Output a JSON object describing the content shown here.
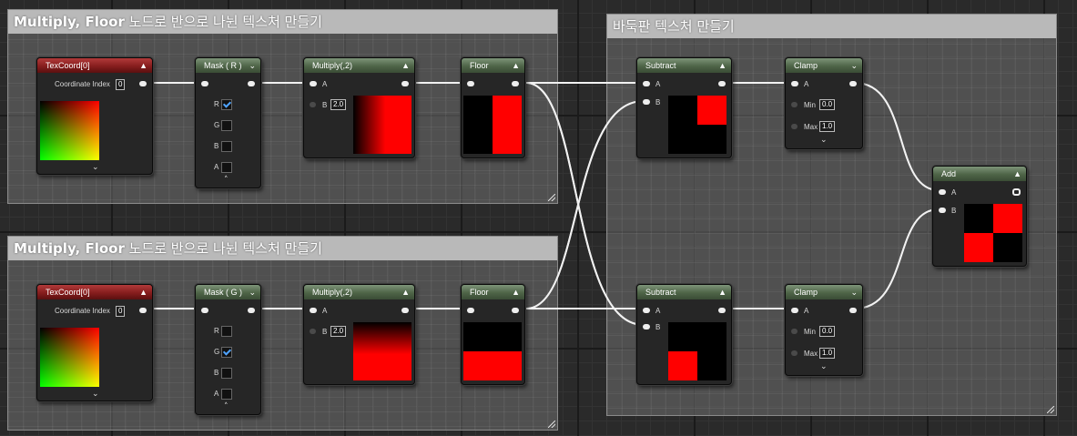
{
  "comments": {
    "top_left": {
      "title_bold": "Multiply, Floor",
      "title_rest": " 노드로 반으로 나뉜 텍스처 만들기"
    },
    "bottom_left": {
      "title_bold": "Multiply, Floor",
      "title_rest": " 노드로 반으로 나뉜 텍스처 만들기"
    },
    "right": {
      "title_bold": "",
      "title_rest": "바둑판 텍스처 만들기"
    }
  },
  "row1": {
    "texcoord": {
      "title": "TexCoord[0]",
      "coord_label": "Coordinate Index",
      "coord_value": "0"
    },
    "mask": {
      "title": "Mask ( R )",
      "channels": [
        "R",
        "G",
        "B",
        "A"
      ],
      "checked": "R"
    },
    "multiply": {
      "title": "Multiply(,2)",
      "in_a": "A",
      "in_b": "B",
      "b_value": "2.0"
    },
    "floor": {
      "title": "Floor"
    },
    "subtract": {
      "title": "Subtract",
      "in_a": "A",
      "in_b": "B"
    },
    "clamp": {
      "title": "Clamp",
      "in_a": "A",
      "min_label": "Min",
      "min_value": "0.0",
      "max_label": "Max",
      "max_value": "1.0"
    }
  },
  "row2": {
    "texcoord": {
      "title": "TexCoord[0]",
      "coord_label": "Coordinate Index",
      "coord_value": "0"
    },
    "mask": {
      "title": "Mask ( G )",
      "channels": [
        "R",
        "G",
        "B",
        "A"
      ],
      "checked": "G"
    },
    "multiply": {
      "title": "Multiply(,2)",
      "in_a": "A",
      "in_b": "B",
      "b_value": "2.0"
    },
    "floor": {
      "title": "Floor"
    },
    "subtract": {
      "title": "Subtract",
      "in_a": "A",
      "in_b": "B"
    },
    "clamp": {
      "title": "Clamp",
      "in_a": "A",
      "min_label": "Min",
      "min_value": "0.0",
      "max_label": "Max",
      "max_value": "1.0"
    }
  },
  "add": {
    "title": "Add",
    "in_a": "A",
    "in_b": "B"
  },
  "colors": {
    "preview_red": "#ff0000",
    "preview_black": "#000000",
    "wire": "#ffffff"
  }
}
